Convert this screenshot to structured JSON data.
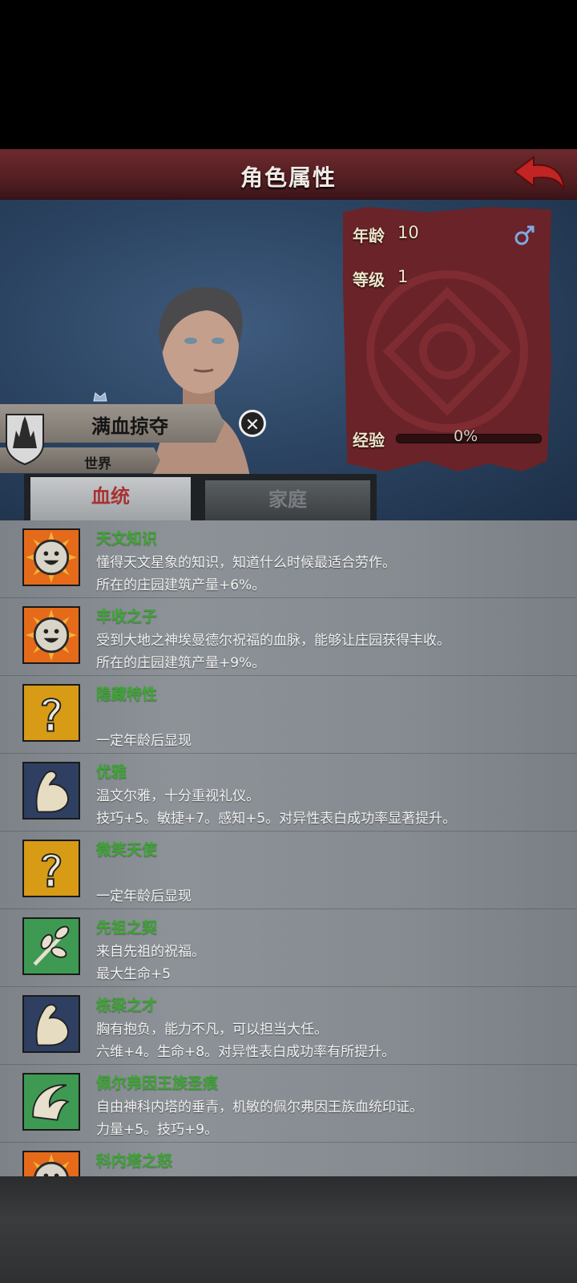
{
  "header": {
    "title": "角色属性"
  },
  "character": {
    "name": "满血掠夺",
    "realm": "世界"
  },
  "stats": {
    "age_label": "年龄",
    "age_value": "10",
    "level_label": "等级",
    "level_value": "1",
    "exp_label": "经验",
    "exp_percent": "0%",
    "exp_fraction": 0
  },
  "tabs": {
    "bloodline": "血统",
    "family": "家庭"
  },
  "traits": [
    {
      "name": "天文知识",
      "desc": "懂得天文星象的知识，知道什么时候最适合劳作。",
      "effect": "所在的庄园建筑产量+6%。",
      "icon": "smile-sun-icon"
    },
    {
      "name": "丰收之子",
      "desc": "受到大地之神埃曼德尔祝福的血脉，能够让庄园获得丰收。",
      "effect": "所在的庄园建筑产量+9%。",
      "icon": "smile-sun-icon"
    },
    {
      "name": "隐藏特性",
      "desc": "",
      "effect": "一定年龄后显现",
      "icon": "question-icon"
    },
    {
      "name": "优雅",
      "desc": "温文尔雅，十分重视礼仪。",
      "effect": "技巧+5。敏捷+7。感知+5。对异性表白成功率显著提升。",
      "icon": "arm-icon"
    },
    {
      "name": "微笑天使",
      "desc": "",
      "effect": "一定年龄后显现",
      "icon": "question-icon"
    },
    {
      "name": "先祖之契",
      "desc": "来自先祖的祝福。",
      "effect": "最大生命+5",
      "icon": "sprout-icon"
    },
    {
      "name": "栋梁之才",
      "desc": "胸有抱负，能力不凡，可以担当大任。",
      "effect": "六维+4。生命+8。对异性表白成功率有所提升。",
      "icon": "arm-icon"
    },
    {
      "name": "佩尔弗因王族圣痕",
      "desc": "自由神科内塔的垂青，机敏的佩尔弗因王族血统印证。",
      "effect": "力量+5。技巧+9。",
      "icon": "wave-icon"
    },
    {
      "name": "科内塔之怒",
      "desc": "",
      "effect": "",
      "icon": "smile-sun-icon"
    }
  ]
}
